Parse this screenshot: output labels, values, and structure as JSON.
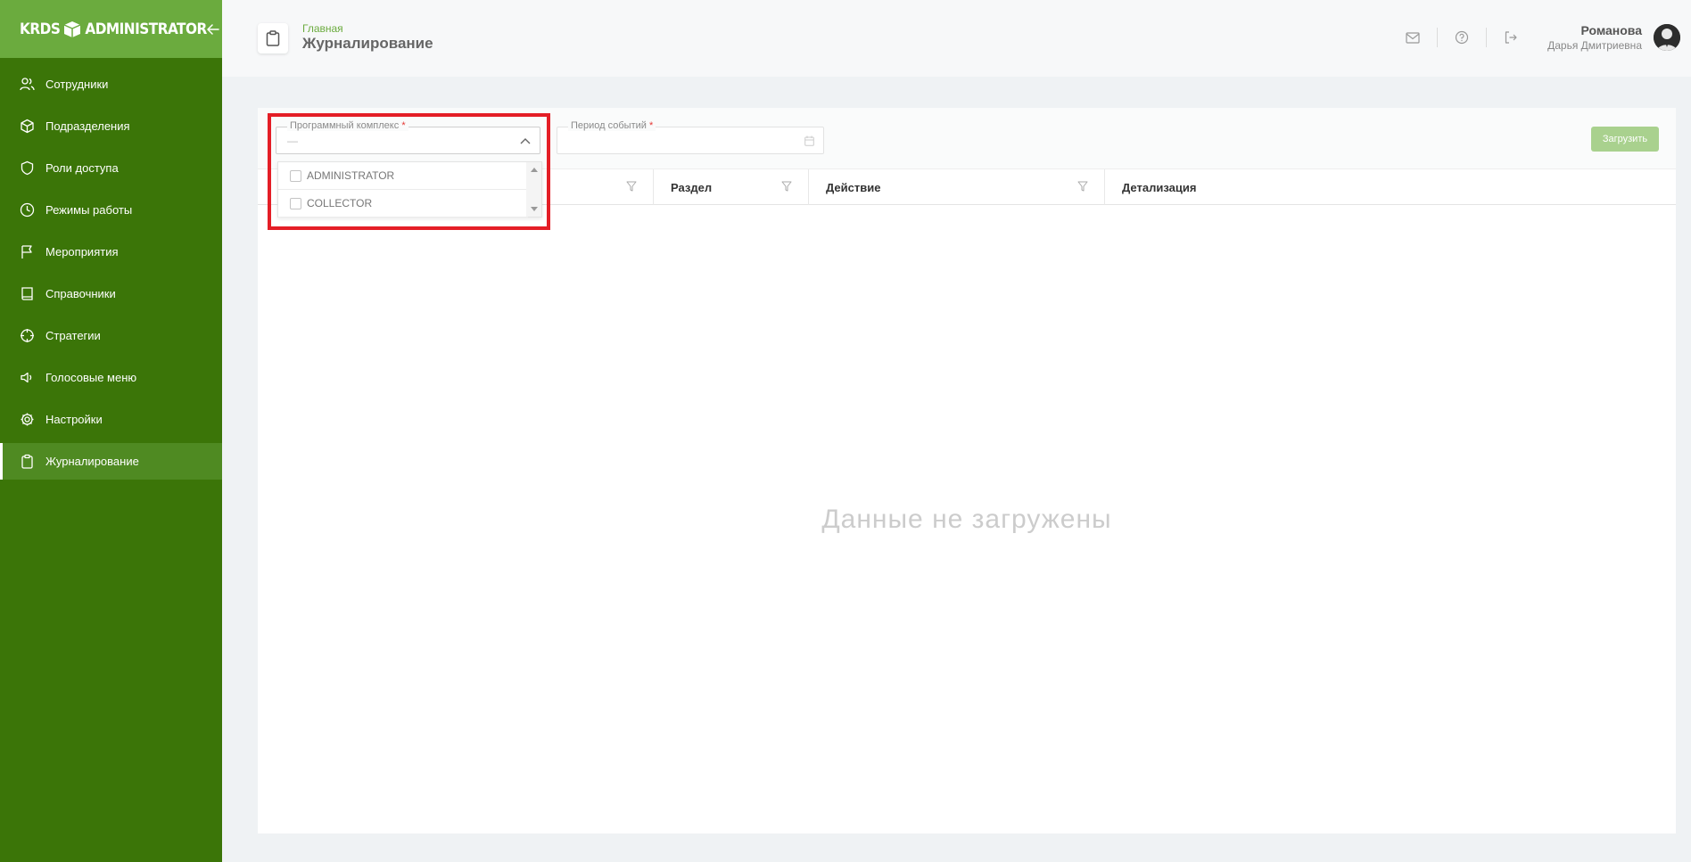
{
  "logo": {
    "left": "KRDS",
    "right": "ADMINISTRATOR"
  },
  "sidebar": {
    "items": [
      {
        "label": "Сотрудники",
        "icon": "users-icon"
      },
      {
        "label": "Подразделения",
        "icon": "cube-icon"
      },
      {
        "label": "Роли доступа",
        "icon": "shield-icon"
      },
      {
        "label": "Режимы работы",
        "icon": "clock-icon"
      },
      {
        "label": "Мероприятия",
        "icon": "flag-icon"
      },
      {
        "label": "Справочники",
        "icon": "book-icon"
      },
      {
        "label": "Стратегии",
        "icon": "crosshair-icon"
      },
      {
        "label": "Голосовые меню",
        "icon": "speaker-icon"
      },
      {
        "label": "Настройки",
        "icon": "gear-icon"
      },
      {
        "label": "Журналирование",
        "icon": "clipboard-icon",
        "active": true
      }
    ]
  },
  "header": {
    "breadcrumb": "Главная",
    "title": "Журналирование",
    "user": {
      "last_name": "Романова",
      "first_name": "Дарья Дмитриевна"
    }
  },
  "filters": {
    "program_label": "Программный комплекс",
    "program_value": "—",
    "period_label": "Период событий",
    "required_mark": "*",
    "load_button": "Загрузить"
  },
  "dropdown": {
    "options": [
      "ADMINISTRATOR",
      "COLLECTOR"
    ]
  },
  "table": {
    "columns": [
      "",
      "Раздел",
      "Действие",
      "Детализация"
    ],
    "empty_text": "Данные не загружены"
  },
  "colors": {
    "sidebar_bg": "#3b7508",
    "logo_bar_bg": "#6bab3e",
    "accent": "#6bab3e",
    "load_button_bg": "#a9d18e",
    "highlight": "#e41e26"
  }
}
